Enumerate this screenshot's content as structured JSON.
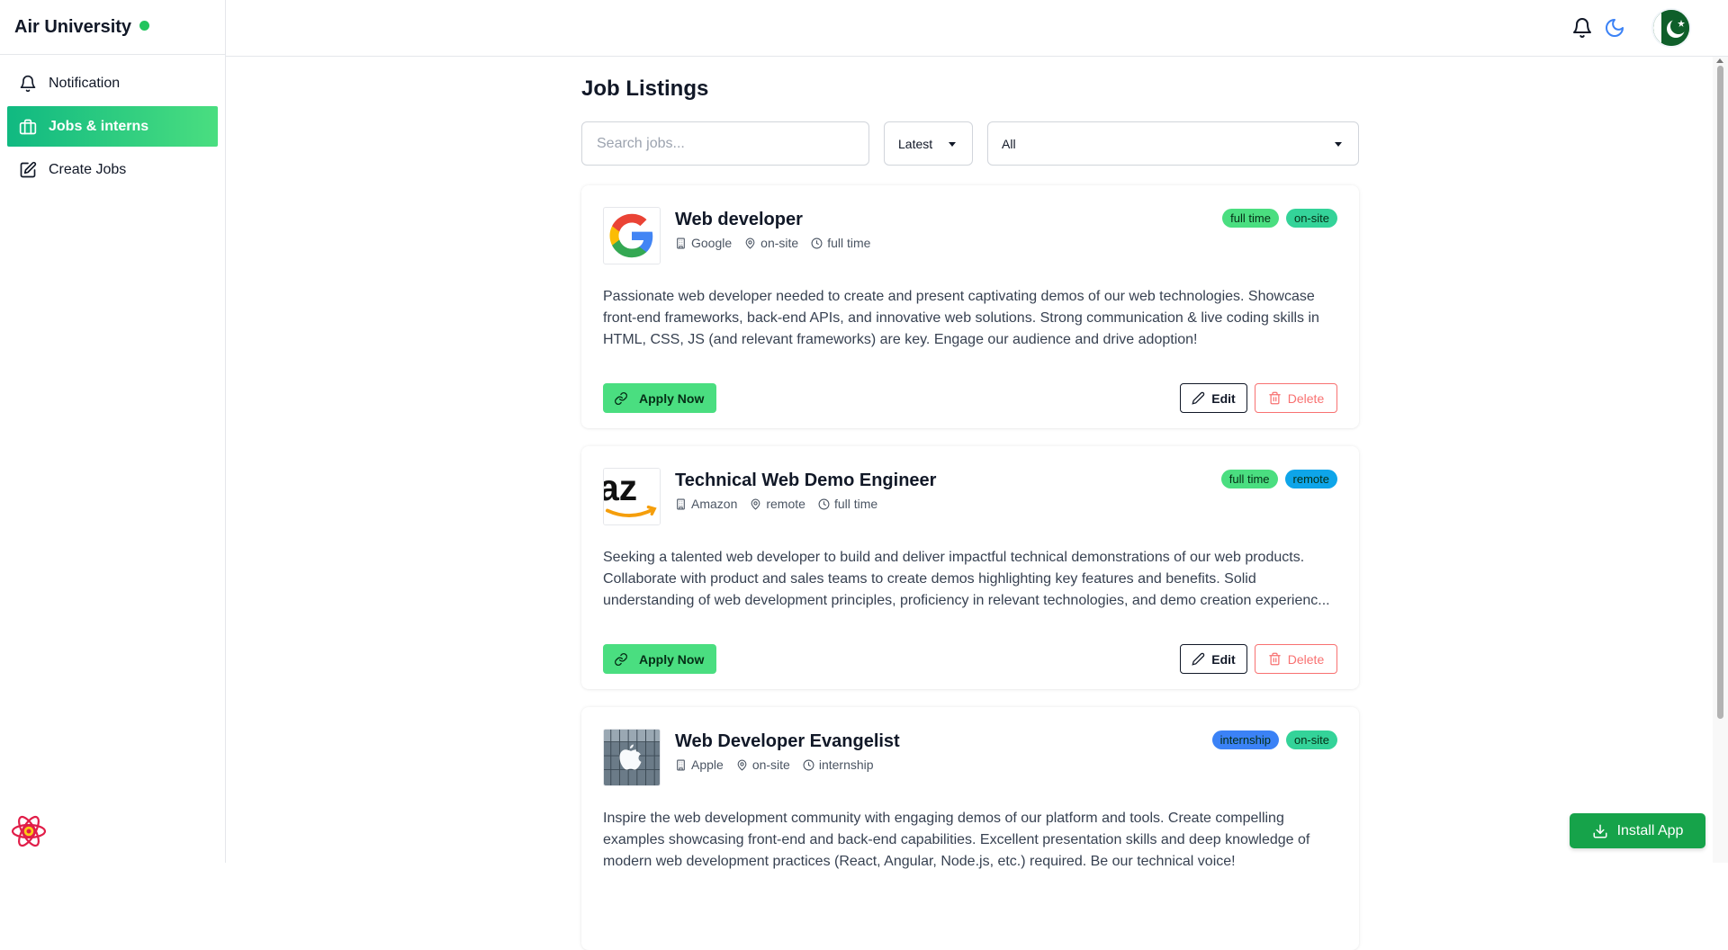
{
  "brand": {
    "title": "Air University",
    "status_color": "#22c55e"
  },
  "sidebar": {
    "items": [
      {
        "label": "Notification",
        "icon": "bell-icon",
        "active": false
      },
      {
        "label": "Jobs & interns",
        "icon": "briefcase-icon",
        "active": true
      },
      {
        "label": "Create Jobs",
        "icon": "pencil-square-icon",
        "active": false
      }
    ]
  },
  "topbar": {
    "icons": [
      "bell-icon",
      "moon-icon",
      "avatar-flag"
    ]
  },
  "main": {
    "title": "Job Listings",
    "search_placeholder": "Search jobs...",
    "sort_value": "Latest",
    "type_value": "All"
  },
  "jobs": [
    {
      "title": "Web developer",
      "company": "Google",
      "location": "on-site",
      "type": "full time",
      "badges": [
        {
          "label": "full time",
          "color": "#4ade80"
        },
        {
          "label": "on-site",
          "color": "#34d399"
        }
      ],
      "description": "Passionate web developer needed to create and present captivating demos of our web technologies. Showcase front-end frameworks, back-end APIs, and innovative web solutions. Strong communication & live coding skills in HTML, CSS, JS (and relevant frameworks) are key. Engage our audience and drive adoption!",
      "logo": "google-logo"
    },
    {
      "title": "Technical Web Demo Engineer",
      "company": "Amazon",
      "location": "remote",
      "type": "full time",
      "badges": [
        {
          "label": "full time",
          "color": "#4ade80"
        },
        {
          "label": "remote",
          "color": "#0ea5e9"
        }
      ],
      "description": "Seeking a talented web developer to build and deliver impactful technical demonstrations of our web products. Collaborate with product and sales teams to create demos highlighting key features and benefits. Solid understanding of web development principles, proficiency in relevant technologies, and demo creation experienc...",
      "logo": "amazon-logo"
    },
    {
      "title": "Web Developer Evangelist",
      "company": "Apple",
      "location": "on-site",
      "type": "internship",
      "badges": [
        {
          "label": "internship",
          "color": "#3b82f6"
        },
        {
          "label": "on-site",
          "color": "#34d399"
        }
      ],
      "description": "Inspire the web development community with engaging demos of our platform and tools. Create compelling examples showcasing front-end and back-end capabilities. Excellent presentation skills and deep knowledge of modern web development practices (React, Angular, Node.js, etc.) required. Be our technical voice!",
      "logo": "apple-logo"
    }
  ],
  "buttons": {
    "apply": "Apply Now",
    "edit": "Edit",
    "delete": "Delete",
    "install": "Install App"
  }
}
